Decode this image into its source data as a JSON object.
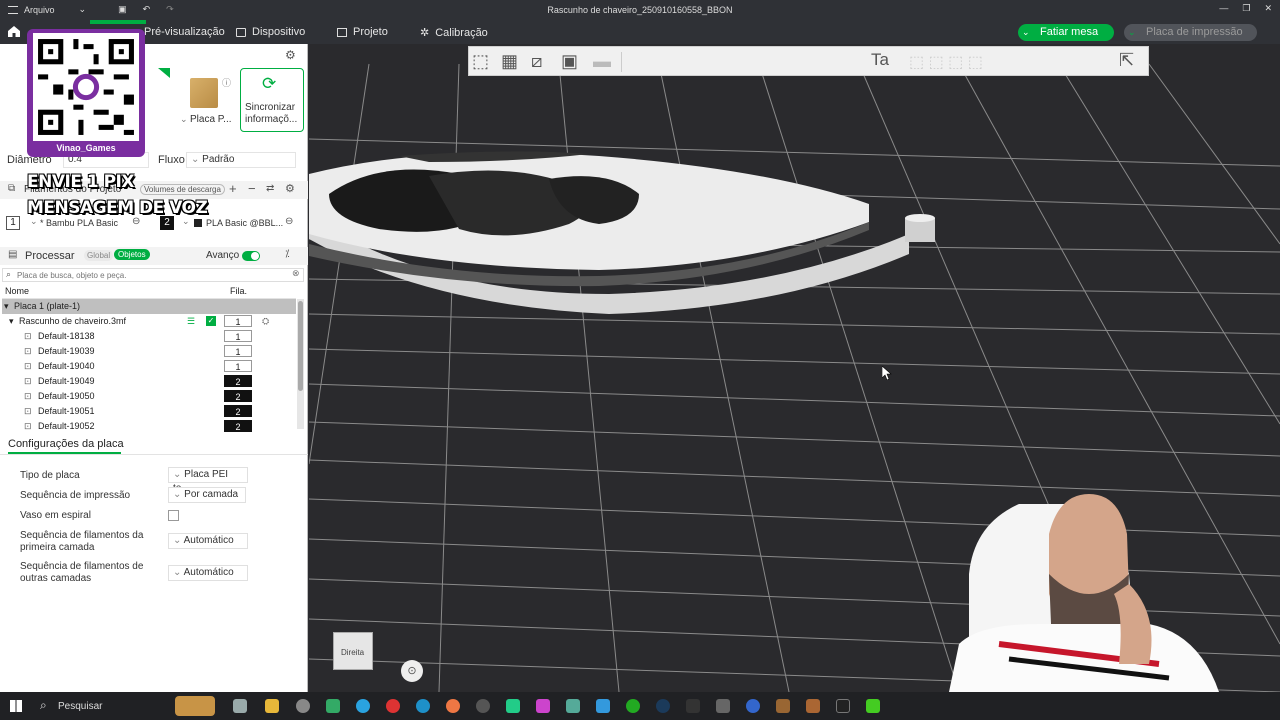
{
  "titlebar": {
    "menu_label": "Arquivo",
    "window_title": "Rascunho de chaveiro_250910160558_BBON"
  },
  "tabs": {
    "preview": "Pré-visualização",
    "device": "Dispositivo",
    "project": "Projeto",
    "calibration": "Calibração"
  },
  "actions": {
    "slice_label": "Fatiar mesa",
    "print_label": "Placa de impressão"
  },
  "printer": {
    "plate_label": "Placa P...",
    "sync_label": "Sincronizar",
    "sync_label2": "informaçõ..."
  },
  "nozzle": {
    "diameter_label": "Diâmetro",
    "diameter_value": "0.4",
    "flow_label": "Fluxo",
    "flow_value": "Padrão"
  },
  "filaments": {
    "section_label": "Filamentos do Projeto",
    "purge_label": "Volumes de descarga",
    "slot1_num": "1",
    "slot1_name": "* Bambu PLA Basic",
    "slot2_num": "2",
    "slot2_name": "PLA Basic @BBL..."
  },
  "process": {
    "label": "Processar",
    "global_label": "Global",
    "objects_label": "Objetos",
    "advanced_label": "Avanço"
  },
  "search": {
    "placeholder": "Placa de busca, objeto e peça."
  },
  "objects": {
    "col_name": "Nome",
    "col_fil": "Fila.",
    "plate_row": "Placa 1 (plate-1)",
    "file_row": "Rascunho de chaveiro.3mf",
    "file_fil": "1",
    "items": [
      {
        "name": "Default-18138",
        "fil": "1",
        "dark": false
      },
      {
        "name": "Default-19039",
        "fil": "1",
        "dark": false
      },
      {
        "name": "Default-19040",
        "fil": "1",
        "dark": false
      },
      {
        "name": "Default-19049",
        "fil": "2",
        "dark": true
      },
      {
        "name": "Default-19050",
        "fil": "2",
        "dark": true
      },
      {
        "name": "Default-19051",
        "fil": "2",
        "dark": true
      },
      {
        "name": "Default-19052",
        "fil": "2",
        "dark": true
      }
    ]
  },
  "plate_settings": {
    "title": "Configurações da placa",
    "plate_type_label": "Tipo de placa",
    "plate_type_value": "Placa PEI te...",
    "print_seq_label": "Sequência de impressão",
    "print_seq_value": "Por camada",
    "spiral_label": "Vaso em espiral",
    "first_layer_label": "Sequência de filamentos da primeira camada",
    "first_layer_value": "Automático",
    "other_layers_label": "Sequência de filamentos de outras camadas",
    "other_layers_value": "Automático"
  },
  "viewport": {
    "view_cube_label": "Direita"
  },
  "overlay": {
    "qr_caption": "Vinao_Games",
    "line1": "ENVIE 1 PIX",
    "line2": "MENSAGEM DE VOZ"
  },
  "taskbar": {
    "search_label": "Pesquisar"
  }
}
